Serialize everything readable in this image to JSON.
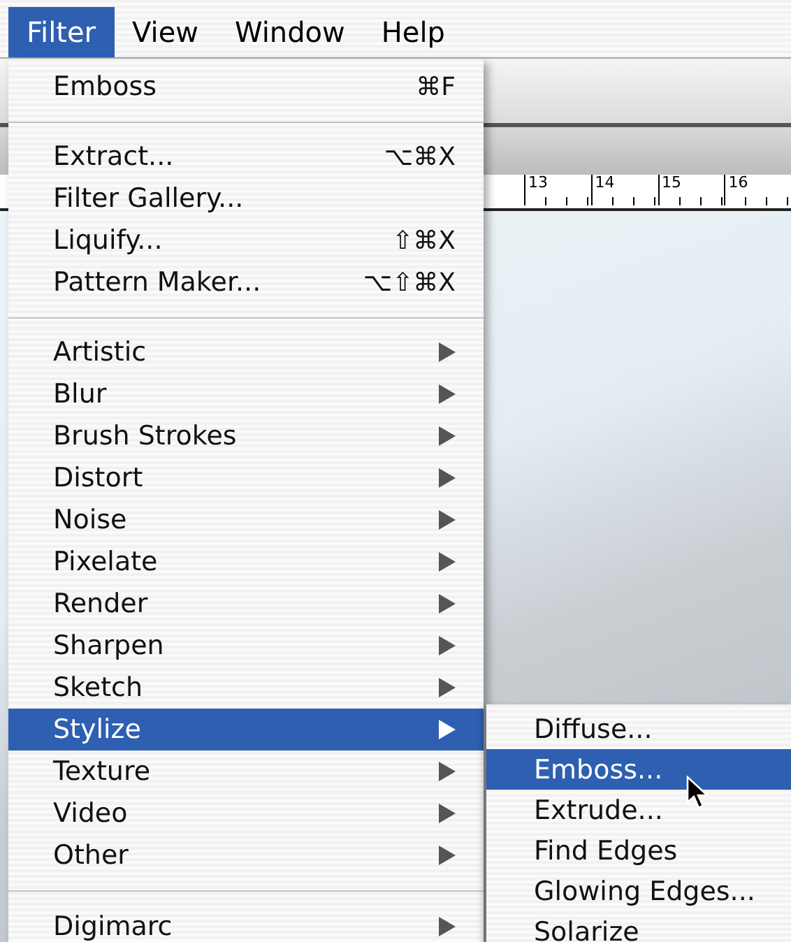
{
  "menu_bar": [
    {
      "label": "Filter",
      "selected": true
    },
    {
      "label": "View",
      "selected": false
    },
    {
      "label": "Window",
      "selected": false
    },
    {
      "label": "Help",
      "selected": false
    }
  ],
  "ruler": {
    "labels": [
      "13",
      "14",
      "15",
      "16"
    ]
  },
  "filter_menu": {
    "items": [
      {
        "kind": "item",
        "label": "Emboss",
        "shortcut": "⌘F"
      },
      {
        "kind": "separator"
      },
      {
        "kind": "item",
        "label": "Extract...",
        "shortcut": "⌥⌘X"
      },
      {
        "kind": "item",
        "label": "Filter Gallery..."
      },
      {
        "kind": "item",
        "label": "Liquify...",
        "shortcut": "⇧⌘X"
      },
      {
        "kind": "item",
        "label": "Pattern Maker...",
        "shortcut": "⌥⇧⌘X"
      },
      {
        "kind": "separator"
      },
      {
        "kind": "submenu",
        "label": "Artistic",
        "selected": false
      },
      {
        "kind": "submenu",
        "label": "Blur",
        "selected": false
      },
      {
        "kind": "submenu",
        "label": "Brush Strokes",
        "selected": false
      },
      {
        "kind": "submenu",
        "label": "Distort",
        "selected": false
      },
      {
        "kind": "submenu",
        "label": "Noise",
        "selected": false
      },
      {
        "kind": "submenu",
        "label": "Pixelate",
        "selected": false
      },
      {
        "kind": "submenu",
        "label": "Render",
        "selected": false
      },
      {
        "kind": "submenu",
        "label": "Sharpen",
        "selected": false
      },
      {
        "kind": "submenu",
        "label": "Sketch",
        "selected": false
      },
      {
        "kind": "submenu",
        "label": "Stylize",
        "selected": true
      },
      {
        "kind": "submenu",
        "label": "Texture",
        "selected": false
      },
      {
        "kind": "submenu",
        "label": "Video",
        "selected": false
      },
      {
        "kind": "submenu",
        "label": "Other",
        "selected": false
      },
      {
        "kind": "separator"
      },
      {
        "kind": "submenu",
        "label": "Digimarc",
        "selected": false
      }
    ]
  },
  "stylize_submenu": {
    "items": [
      {
        "label": "Diffuse...",
        "selected": false
      },
      {
        "label": "Emboss...",
        "selected": true
      },
      {
        "label": "Extrude...",
        "selected": false
      },
      {
        "label": "Find Edges",
        "selected": false
      },
      {
        "label": "Glowing Edges...",
        "selected": false
      },
      {
        "label": "Solarize",
        "selected": false
      }
    ]
  }
}
